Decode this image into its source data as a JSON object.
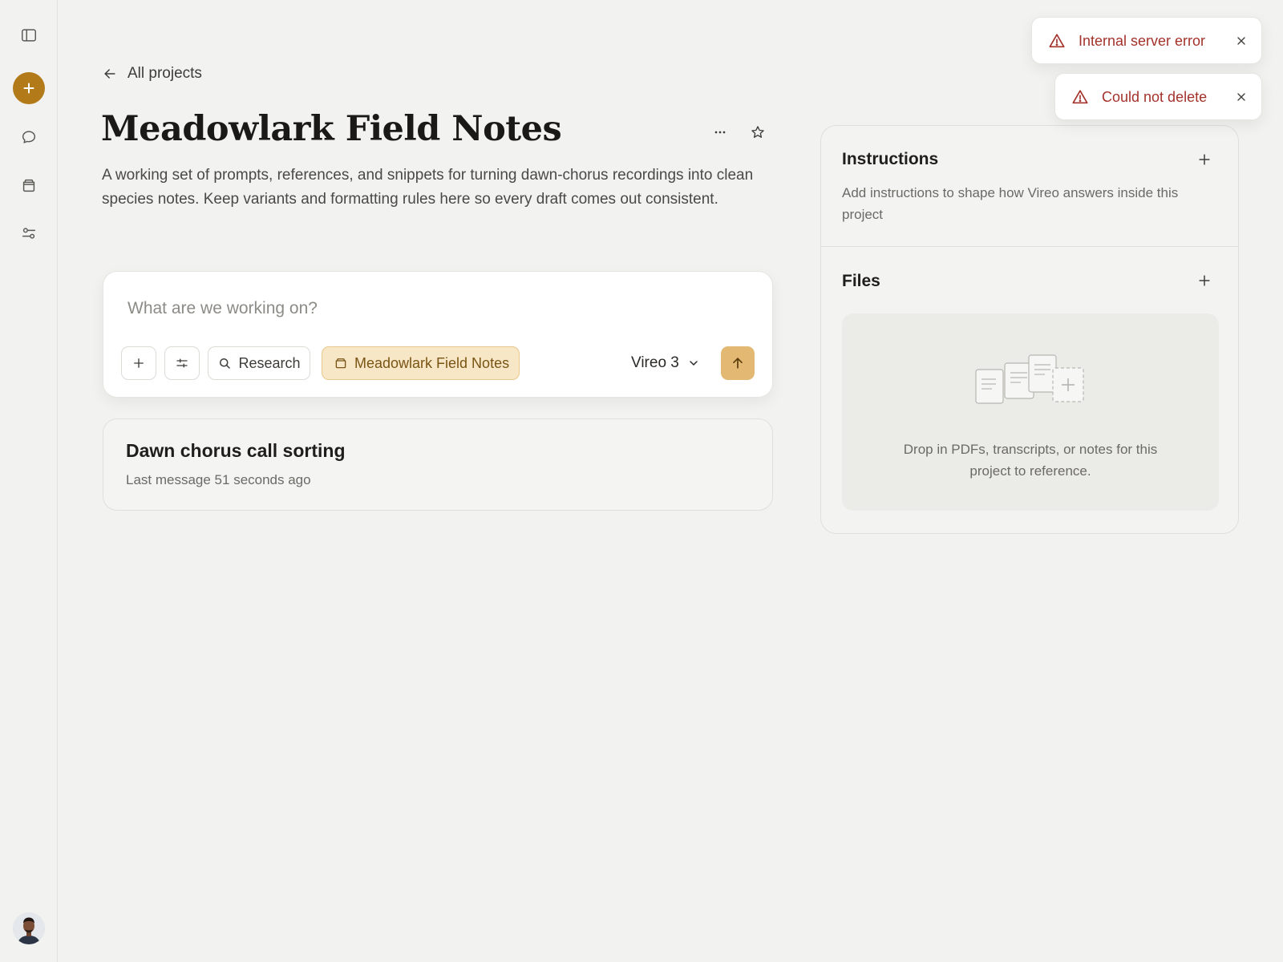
{
  "sidebar": {
    "items": [
      {
        "icon": "sidebar-toggle-icon"
      },
      {
        "icon": "plus-icon"
      },
      {
        "icon": "chat-bubble-icon"
      },
      {
        "icon": "projects-icon"
      },
      {
        "icon": "sliders-icon"
      }
    ],
    "accent_color": "#b27a18"
  },
  "nav": {
    "back_label": "All projects"
  },
  "project": {
    "title": "Meadowlark Field Notes",
    "description": "A working set of prompts, references, and snippets for turning dawn-chorus recordings into clean species notes. Keep variants and formatting rules here so every draft comes out consistent."
  },
  "composer": {
    "placeholder": "What are we working on?",
    "research_label": "Research",
    "project_chip_label": "Meadowlark Field Notes",
    "model_label": "Vireo 3"
  },
  "chats": [
    {
      "title": "Dawn chorus call sorting",
      "meta": "Last message 51 seconds ago"
    }
  ],
  "panel": {
    "instructions": {
      "heading": "Instructions",
      "description": "Add instructions to shape how Vireo answers inside this project"
    },
    "files": {
      "heading": "Files",
      "dropzone_text": "Drop in PDFs, transcripts, or notes for this project to reference."
    }
  },
  "toasts": [
    {
      "message": "Internal server error",
      "color": "#a3322b"
    },
    {
      "message": "Could not delete",
      "color": "#a3322b"
    }
  ]
}
